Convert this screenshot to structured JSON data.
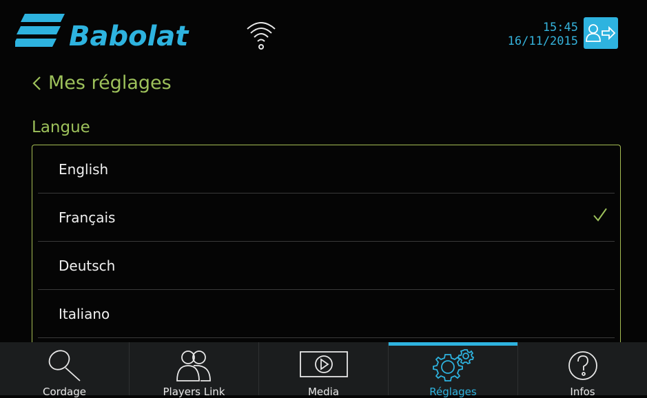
{
  "header": {
    "brand": "Babolat",
    "time": "15:45",
    "date": "16/11/2015",
    "icons": {
      "wifi": "wifi-icon",
      "logout": "user-logout-icon"
    }
  },
  "page": {
    "back_label": "Mes réglages",
    "section_title": "Langue"
  },
  "languages": [
    {
      "label": "English",
      "selected": false
    },
    {
      "label": "Français",
      "selected": true
    },
    {
      "label": "Deutsch",
      "selected": false
    },
    {
      "label": "Italiano",
      "selected": false
    }
  ],
  "tabs": [
    {
      "label": "Cordage",
      "icon": "racket-icon",
      "active": false
    },
    {
      "label": "Players Link",
      "icon": "players-icon",
      "active": false
    },
    {
      "label": "Media",
      "icon": "play-icon",
      "active": false
    },
    {
      "label": "Réglages",
      "icon": "gears-icon",
      "active": true
    },
    {
      "label": "Infos",
      "icon": "question-icon",
      "active": false
    }
  ],
  "colors": {
    "accent_blue": "#2eb3df",
    "accent_green": "#9dc15b",
    "background": "#050505",
    "tabbar": "#1b1d1e"
  }
}
